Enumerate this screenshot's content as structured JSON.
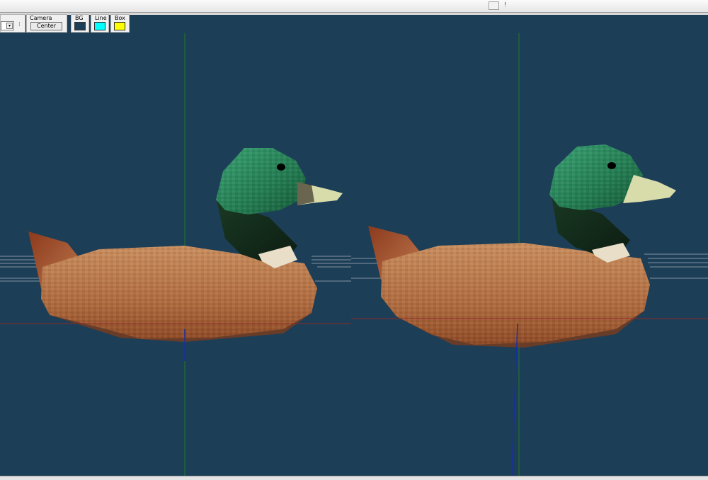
{
  "window": {
    "title_controls": [
      "",
      "!"
    ]
  },
  "toolbar": {
    "camera_label": "Camera",
    "center_button": "Center",
    "bg_label": "BG",
    "line_label": "Line",
    "box_label": "Box",
    "dropdown_value": "",
    "dropdown_separator": "⁞"
  },
  "colors": {
    "background": "#1d3e57",
    "bg_swatch": "#1d3e57",
    "line_swatch": "#00ffff",
    "box_swatch": "#ffff00",
    "grid_line": "#cfd6dc",
    "axis_x": "#8a2a2a",
    "axis_y": "#1f7a2a",
    "axis_z": "#1a2fa0",
    "duck_head": "#2b8a5c",
    "duck_body": "#b9774a"
  },
  "scene": {
    "models": [
      "duck-left",
      "duck-right"
    ]
  }
}
